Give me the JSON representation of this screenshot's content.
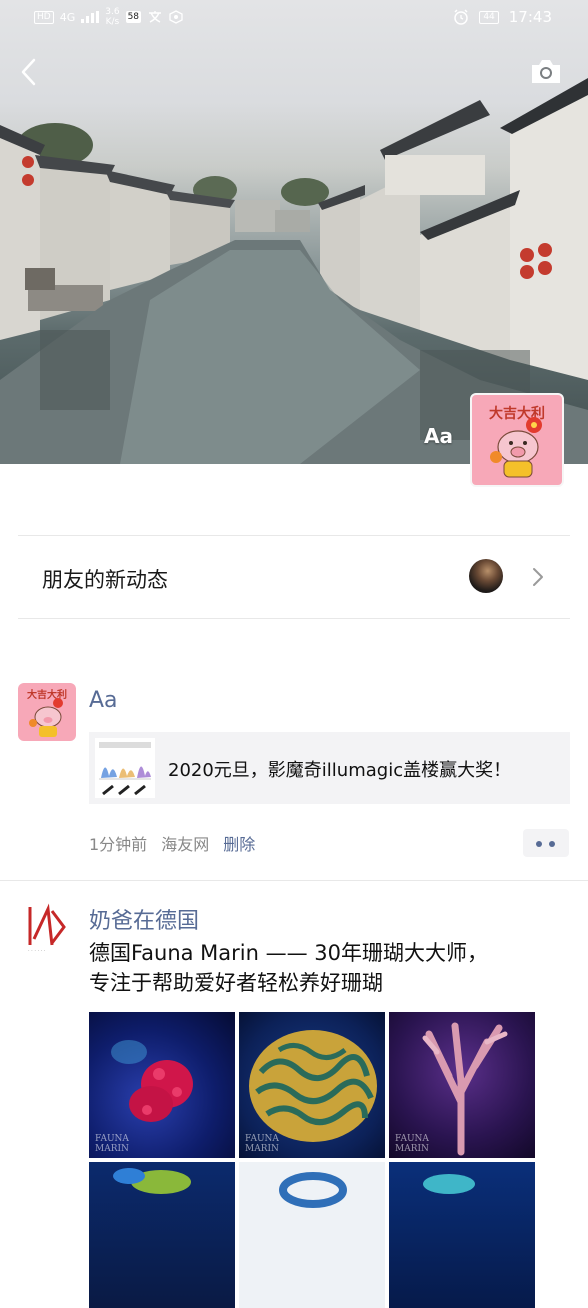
{
  "status_bar": {
    "hd": "HD",
    "network": "4G",
    "speed_value": "3.6",
    "speed_unit": "K/s",
    "app_badge": "58",
    "time": "17:43",
    "battery": "44"
  },
  "cover": {
    "owner_name": "Aa",
    "avatar_caption": "大吉大利"
  },
  "friends_updates": {
    "label": "朋友的新动态"
  },
  "posts": [
    {
      "author": "Aa",
      "avatar_caption": "大吉大利",
      "share_title": "2020元旦，影魔奇illumagic盖楼赢大奖！",
      "time": "1分钟前",
      "source": "海友网",
      "delete_label": "删除"
    },
    {
      "author": "奶爸在德国",
      "text_line1": "德国Fauna Marin —— 30年珊瑚大大师，",
      "text_line2": "专注于帮助爱好者轻松养好珊瑚",
      "watermark_line1": "FAUNA",
      "watermark_line2": "MARIN"
    }
  ],
  "colors": {
    "link": "#576b95",
    "card_bg": "#f3f3f5",
    "avatar_pink": "#f7a8b8"
  },
  "icons": [
    "back-icon",
    "camera-icon",
    "chevron-right-icon",
    "more-icon"
  ]
}
